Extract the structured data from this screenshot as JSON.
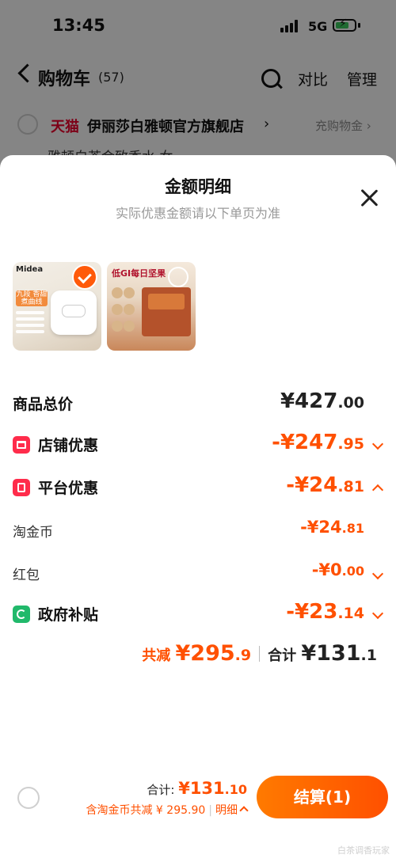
{
  "status_bar": {
    "time": "13:45",
    "network": "5G"
  },
  "nav": {
    "title": "购物车",
    "count": "(57)",
    "compare": "对比",
    "manage": "管理"
  },
  "store": {
    "platform": "天猫",
    "name": "伊丽莎白雅顿官方旗舰店",
    "arrow": "›",
    "coupon": "充购物金 ›"
  },
  "peek_text": "雅顿白茶金致香水 女",
  "sheet": {
    "title": "金额明细",
    "subtitle": "实际优惠金额请以下单页为准",
    "products": [
      {
        "brand": "Midea",
        "tag": "九段\n香甜煮曲线",
        "selected": true
      },
      {
        "banner": "低GI每日坚果",
        "selected": false
      }
    ],
    "rows": {
      "total_label": "商品总价",
      "total_int": "¥427",
      "total_dec": ".00",
      "store_label": "店铺优惠",
      "store_int": "-¥247",
      "store_dec": ".95",
      "platform_label": "平台优惠",
      "platform_int": "-¥24",
      "platform_dec": ".81",
      "coin_label": "淘金币",
      "coin_int": "-¥24",
      "coin_dec": ".81",
      "redpacket_label": "红包",
      "redpacket_int": "-¥0",
      "redpacket_dec": ".00",
      "gov_label": "政府补贴",
      "gov_int": "-¥23",
      "gov_dec": ".14"
    },
    "summary": {
      "saved_label": "共减 ",
      "saved_int": "¥295",
      "saved_dec": ".9",
      "total_label": "合计 ",
      "total_int": "¥131",
      "total_dec": ".1"
    }
  },
  "footer": {
    "total_label": "合计: ",
    "total_int": "¥131",
    "total_dec": ".10",
    "saving_text": "含淘金币共减 ¥ 295.90",
    "separator": "|",
    "detail_label": "明细",
    "checkout_label": "结算(1)"
  },
  "watermark": "白茶调香玩家",
  "colors": {
    "accent": "#ff5000",
    "tmall_red": "#e4002b",
    "gov_green": "#21b96b"
  }
}
